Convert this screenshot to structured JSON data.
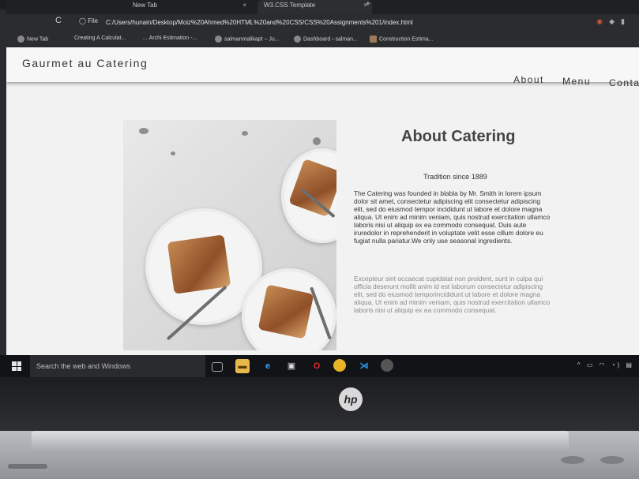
{
  "browser": {
    "tabs": [
      {
        "title": "New Tab"
      },
      {
        "title": "W3.CSS Template"
      }
    ],
    "close_glyph": "×",
    "new_tab_glyph": "+",
    "reload_glyph": "C",
    "info_label": "File",
    "url": "C:/Users/hunain/Desktop/Moiz%20Ahmed%20HTML%20and%20CSS/CSS%20Assignments%201/index.html",
    "bookmarks": [
      {
        "label": "New Tab"
      },
      {
        "label": "Creating A Calculat..."
      },
      {
        "label": "Archi Estimation -..."
      },
      {
        "label": "salmanmalikapt – Ju..."
      },
      {
        "label": "Dashboard ‹ salman..."
      },
      {
        "label": "Construction Estima..."
      }
    ]
  },
  "site": {
    "brand": "Gaurmet au Catering",
    "nav": [
      {
        "label": "About"
      },
      {
        "label": "Menu"
      },
      {
        "label": "Conta"
      }
    ],
    "about": {
      "title": "About Catering",
      "tradition": "Tradition since 1889",
      "paragraph1": "The Catering was founded in blabla by Mr. Smith in lorem ipsum dolor sit amet, consectetur adipiscing elit consectetur adipiscing elit, sed do eiusmod tempor incididunt ut labore et dolore magna aliqua. Ut enim ad minim veniam, quis nostrud exercitation ullamco laboris nisi ut aliquip ex ea commodo consequat. Duis aute iruredolor in reprehenderit in voluptate velit esse cillum dolore eu fugiat nulla pariatur.We only use seasonal ingredients.",
      "paragraph2": "Excepteur sint occaecat cupidatat non proident, sunt in culpa qui officia deserunt mollit anim id est laborum consectetur adipiscing elit, sed do eiusmod temporincididunt ut labore et dolore magna aliqua. Ut enim ad minim veniam, quis nostrud exercitation ullamco laboris nisi ut aliquip ex ea commodo consequat."
    }
  },
  "taskbar": {
    "search_placeholder": "Search the web and Windows",
    "apps": [
      "task-view",
      "file-explorer",
      "edge",
      "store",
      "opera",
      "chrome",
      "vscode",
      "chrome-canary"
    ]
  },
  "laptop": {
    "logo": "hp"
  },
  "colors": {
    "page_bg": "#f2f2f2",
    "header_bg": "#f7f7f7",
    "text": "#333333",
    "muted_text": "#8a8a8a",
    "taskbar": "#121316"
  }
}
